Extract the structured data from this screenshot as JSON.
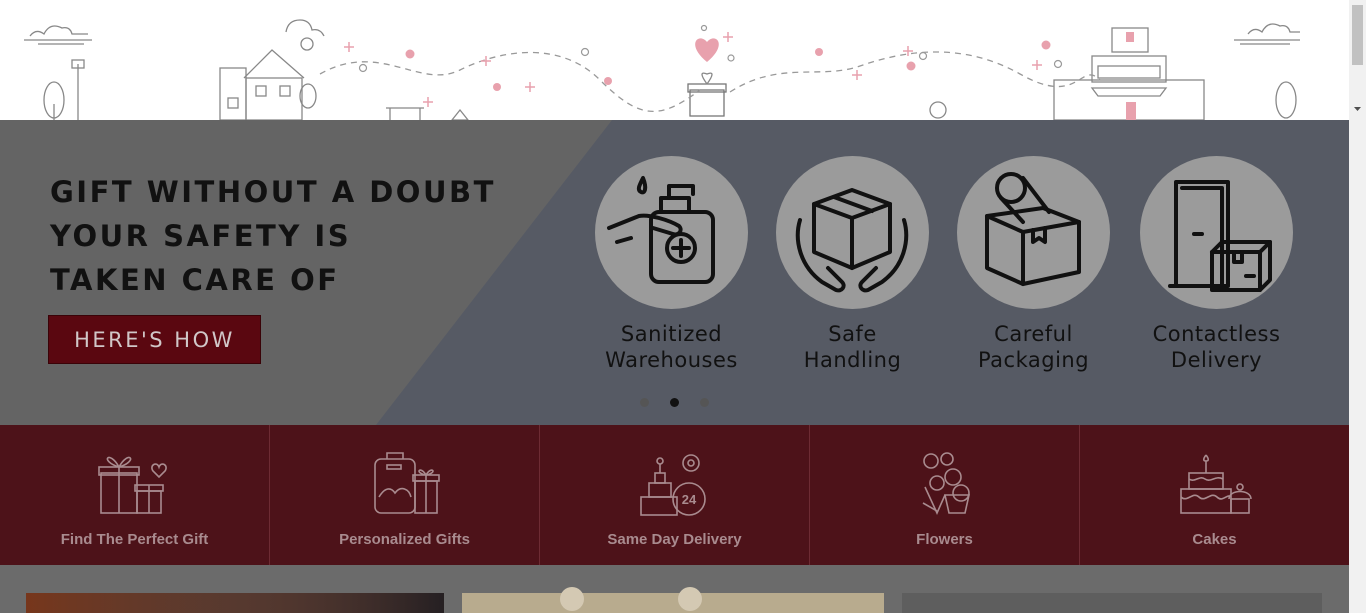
{
  "hero": {
    "heading_lines": [
      "GIFT WITHOUT A DOUBT",
      "YOUR SAFETY IS",
      "TAKEN CARE OF"
    ],
    "cta_label": "HERE'S HOW",
    "features": [
      {
        "line1": "Sanitized",
        "line2": "Warehouses",
        "icon": "hand-sanitizer-icon"
      },
      {
        "line1": "Safe",
        "line2": "Handling",
        "icon": "hands-holding-box-icon"
      },
      {
        "line1": "Careful",
        "line2": "Packaging",
        "icon": "taped-box-icon"
      },
      {
        "line1": "Contactless",
        "line2": "Delivery",
        "icon": "door-with-parcel-icon"
      }
    ],
    "carousel": {
      "slides": 3,
      "active_index": 1
    }
  },
  "categories": [
    {
      "label": "Find The Perfect Gift",
      "icon": "gift-boxes-icon"
    },
    {
      "label": "Personalized Gifts",
      "icon": "personalized-bag-icon"
    },
    {
      "label": "Same Day Delivery",
      "icon": "cake-24-hours-icon"
    },
    {
      "label": "Flowers",
      "icon": "flower-bouquet-icon"
    },
    {
      "label": "Cakes",
      "icon": "cake-icon"
    }
  ],
  "colors": {
    "hero_cta": "#5a0710",
    "category_bar": "#4d1219",
    "category_text": "#a98b8f",
    "illustration_accent": "#e8a1ad"
  }
}
